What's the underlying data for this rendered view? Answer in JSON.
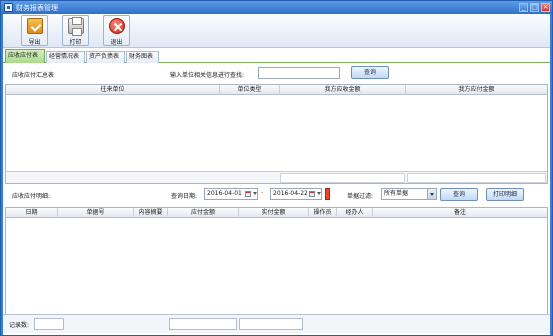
{
  "window": {
    "title": "财务报表管理",
    "controls": {
      "minimize": "_",
      "maximize": "□",
      "close": "×"
    }
  },
  "toolbar": {
    "export_label": "导出",
    "print_label": "打印",
    "exit_label": "退出"
  },
  "tabs": [
    {
      "label": "应收应付表",
      "active": true
    },
    {
      "label": "经营情况表",
      "active": false
    },
    {
      "label": "资产负债表",
      "active": false
    },
    {
      "label": "财务图表",
      "active": false
    }
  ],
  "summary": {
    "section_label": "应收应付汇总表",
    "search_hint": "输入单位相关信息进行查找:",
    "search_value": "",
    "query_button": "查询",
    "columns": [
      "往来单位",
      "单位类型",
      "我方应收金额",
      "我方应付金额"
    ],
    "rows": []
  },
  "detail": {
    "section_label": "应收应付明细:",
    "query_date_label": "查询日期:",
    "start_date": "2016-04-01",
    "date_separator": "-",
    "end_date": "2016-04-22",
    "filter_label": "单据过滤:",
    "filter_value": "所有单据",
    "query_button": "查询",
    "print_button": "打印明细",
    "columns": [
      "日期",
      "单据号",
      "内容摘要",
      "应付金额",
      "实付金额",
      "操作员",
      "经办人",
      "备注"
    ],
    "rows": []
  },
  "status": {
    "record_count_label": "记录数:",
    "record_count": ""
  },
  "colors": {
    "titlebar": "#2f70c8",
    "active_tab": "#a9d98a",
    "button": "#c4d8f2"
  }
}
